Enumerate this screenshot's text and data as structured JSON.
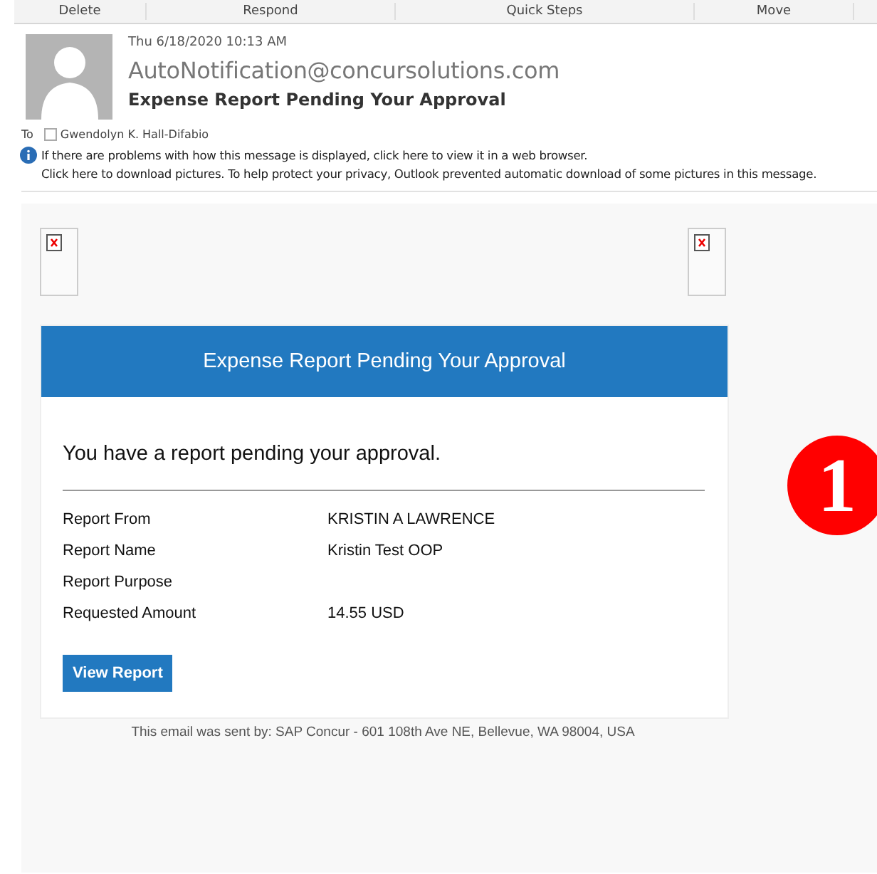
{
  "ribbon_groups": [
    "Delete",
    "Respond",
    "Quick Steps",
    "Move"
  ],
  "message": {
    "date": "Thu 6/18/2020 10:13 AM",
    "sender": "AutoNotification@concursolutions.com",
    "subject": "Expense Report Pending Your Approval",
    "to_label": "To",
    "recipient": "Gwendolyn K. Hall-Difabio",
    "info_lines": [
      "If there are problems with how this message is displayed, click here to view it in a web browser.",
      "Click here to download pictures. To help protect your privacy, Outlook prevented automatic download of some pictures in this message."
    ]
  },
  "email": {
    "banner": "Expense Report Pending Your Approval",
    "intro": "You have a report pending your approval.",
    "fields": [
      {
        "label": "Report From",
        "value": "KRISTIN A LAWRENCE"
      },
      {
        "label": "Report Name",
        "value": "Kristin Test OOP"
      },
      {
        "label": "Report Purpose"
      },
      {
        "label": "Requested Amount",
        "value": "14.55 USD"
      }
    ],
    "button": "View Report",
    "footer": "This email was sent by: SAP Concur - 601 108th Ave NE, Bellevue, WA 98004, USA"
  },
  "annotation": "1"
}
